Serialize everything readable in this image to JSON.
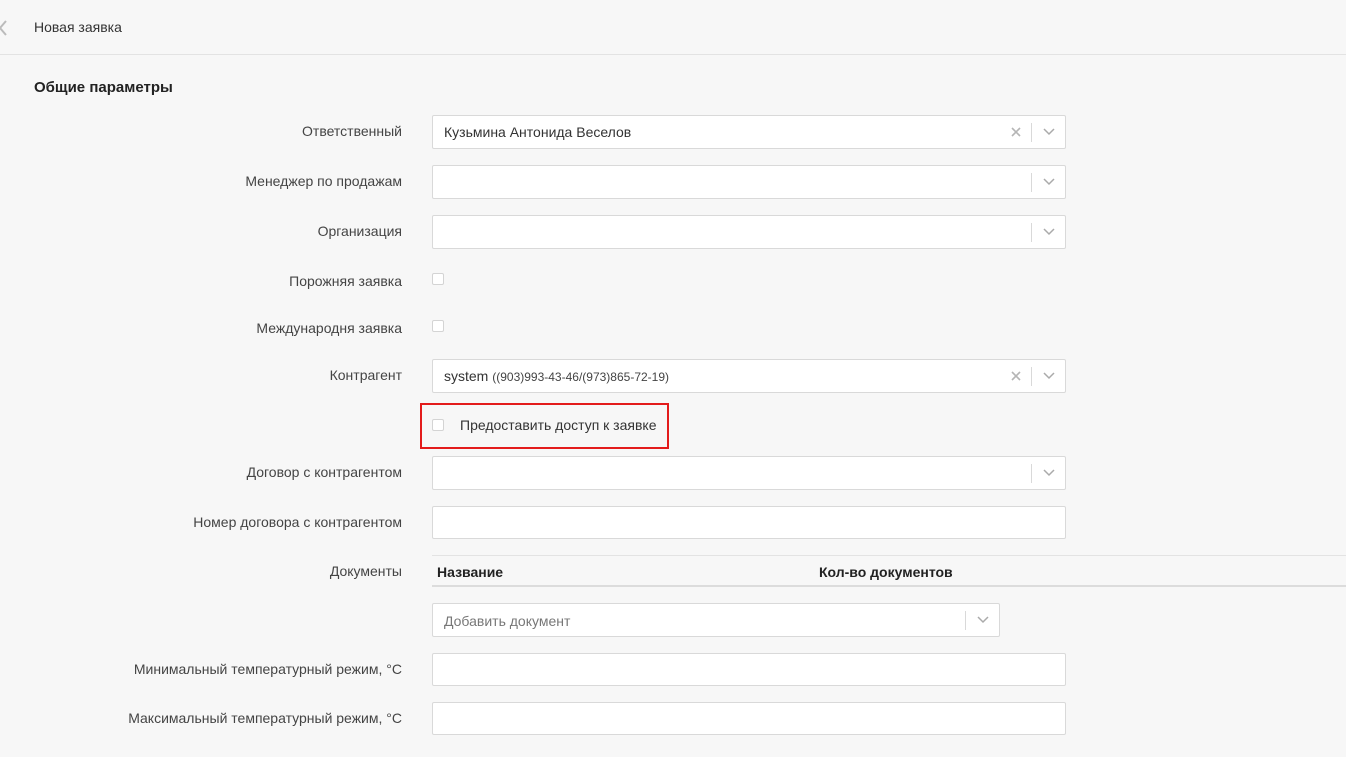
{
  "header": {
    "title": "Новая заявка"
  },
  "section": {
    "title": "Общие параметры"
  },
  "fields": {
    "responsible": {
      "label": "Ответственный",
      "value": "Кузьмина Антонида Веселов"
    },
    "sales_manager": {
      "label": "Менеджер по продажам",
      "value": ""
    },
    "organization": {
      "label": "Организация",
      "value": ""
    },
    "empty_request": {
      "label": "Порожняя заявка",
      "checked": false
    },
    "international_request": {
      "label": "Международня заявка",
      "checked": false
    },
    "counterparty": {
      "label": "Контрагент",
      "value": "system",
      "value_extra": "((903)993-43-46/(973)865-72-19)"
    },
    "grant_access": {
      "label": "Предоставить доступ к заявке",
      "checked": false,
      "highlight_color": "#e31b1b"
    },
    "contract": {
      "label": "Договор с контрагентом",
      "value": ""
    },
    "contract_number": {
      "label": "Номер договора с контрагентом",
      "value": ""
    },
    "documents": {
      "label": "Документы",
      "columns": [
        "Название",
        "Кол-во документов"
      ],
      "add_placeholder": "Добавить документ"
    },
    "min_temp": {
      "label": "Минимальный температурный режим, °C",
      "value": ""
    },
    "max_temp": {
      "label": "Максимальный температурный режим, °C",
      "value": ""
    }
  },
  "icons": {
    "back": "chevron-left-icon",
    "clear": "close-icon",
    "dropdown": "chevron-down-icon"
  }
}
